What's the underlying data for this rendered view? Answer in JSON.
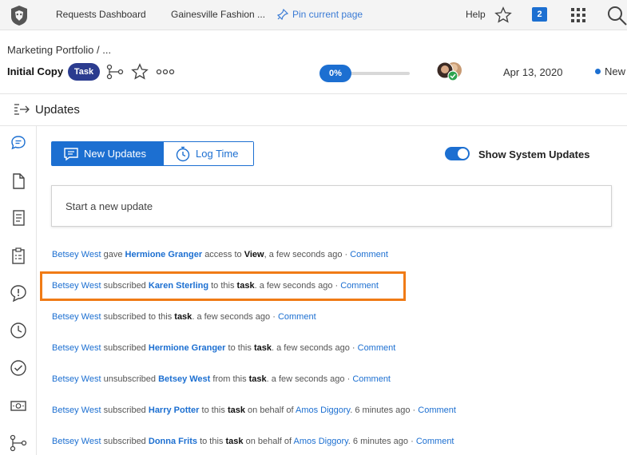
{
  "topbar": {
    "requests_dashboard": "Requests Dashboard",
    "gainesville": "Gainesville Fashion ...",
    "pin_label": "Pin current page",
    "help": "Help",
    "notification_count": "2"
  },
  "header": {
    "breadcrumb": "Marketing Portfolio  /  ...",
    "title": "Initial Copy",
    "badge": "Task",
    "progress": "0%",
    "progress_value": 0,
    "date": "Apr 13, 2020",
    "status": "New"
  },
  "section": {
    "title": "Updates"
  },
  "tabs": {
    "new_updates": "New Updates",
    "log_time": "Log Time"
  },
  "toggle": {
    "label": "Show System Updates",
    "on": true
  },
  "composer": {
    "placeholder": "Start a new update"
  },
  "feed": [
    {
      "actor": "Betsey West",
      "verb": "gave",
      "target": "Hermione Granger",
      "mid": "access to",
      "obj": "View",
      "punct": ",",
      "time": "a few seconds ago",
      "action": "Comment"
    },
    {
      "actor": "Betsey West",
      "verb": "subscribed",
      "target": "Karen Sterling",
      "mid": "to this",
      "obj": "task",
      "punct": ".",
      "time": "a few seconds ago",
      "action": "Comment"
    },
    {
      "actor": "Betsey West",
      "verb": "subscribed to this",
      "obj": "task",
      "punct": ".",
      "time": "a few seconds ago",
      "action": "Comment"
    },
    {
      "actor": "Betsey West",
      "verb": "subscribed",
      "target": "Hermione Granger",
      "mid": "to this",
      "obj": "task",
      "punct": ".",
      "time": "a few seconds ago",
      "action": "Comment"
    },
    {
      "actor": "Betsey West",
      "verb": "unsubscribed",
      "target": "Betsey West",
      "mid": "from this",
      "obj": "task",
      "punct": ".",
      "time": "a few seconds ago",
      "action": "Comment"
    },
    {
      "actor": "Betsey West",
      "verb": "subscribed",
      "target": "Harry Potter",
      "mid": "to this",
      "obj": "task",
      "extra": "on behalf of",
      "behalf": "Amos Diggory",
      "punct": ".",
      "time": "6 minutes ago",
      "action": "Comment"
    },
    {
      "actor": "Betsey West",
      "verb": "subscribed",
      "target": "Donna Frits",
      "mid": "to this",
      "obj": "task",
      "extra": "on behalf of",
      "behalf": "Amos Diggory",
      "punct": ".",
      "time": "6 minutes ago",
      "action": "Comment"
    }
  ],
  "colors": {
    "accent": "#1c6fd1",
    "badge_bg": "#2b3c8f",
    "highlight": "#f07b16"
  }
}
